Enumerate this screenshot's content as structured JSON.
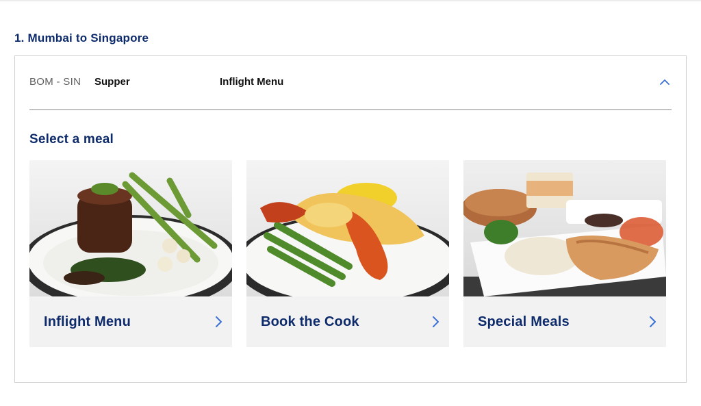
{
  "segment": {
    "title": "1. Mumbai to Singapore"
  },
  "flight": {
    "route": "BOM - SIN",
    "service": "Supper",
    "menu": "Inflight Menu",
    "collapse_icon": "chevron-up-icon"
  },
  "meals": {
    "heading": "Select a meal",
    "options": [
      {
        "label": "Inflight Menu",
        "image": "steak-dish-photo",
        "icon": "chevron-right-icon"
      },
      {
        "label": "Book the Cook",
        "image": "lobster-dish-photo",
        "icon": "chevron-right-icon"
      },
      {
        "label": "Special Meals",
        "image": "chicken-rice-tray-photo",
        "icon": "chevron-right-icon"
      }
    ]
  },
  "colors": {
    "heading": "#0d2a6b",
    "accent": "#3a6fd8",
    "tile_bg": "#f2f2f3",
    "border": "#cfcfcf"
  }
}
